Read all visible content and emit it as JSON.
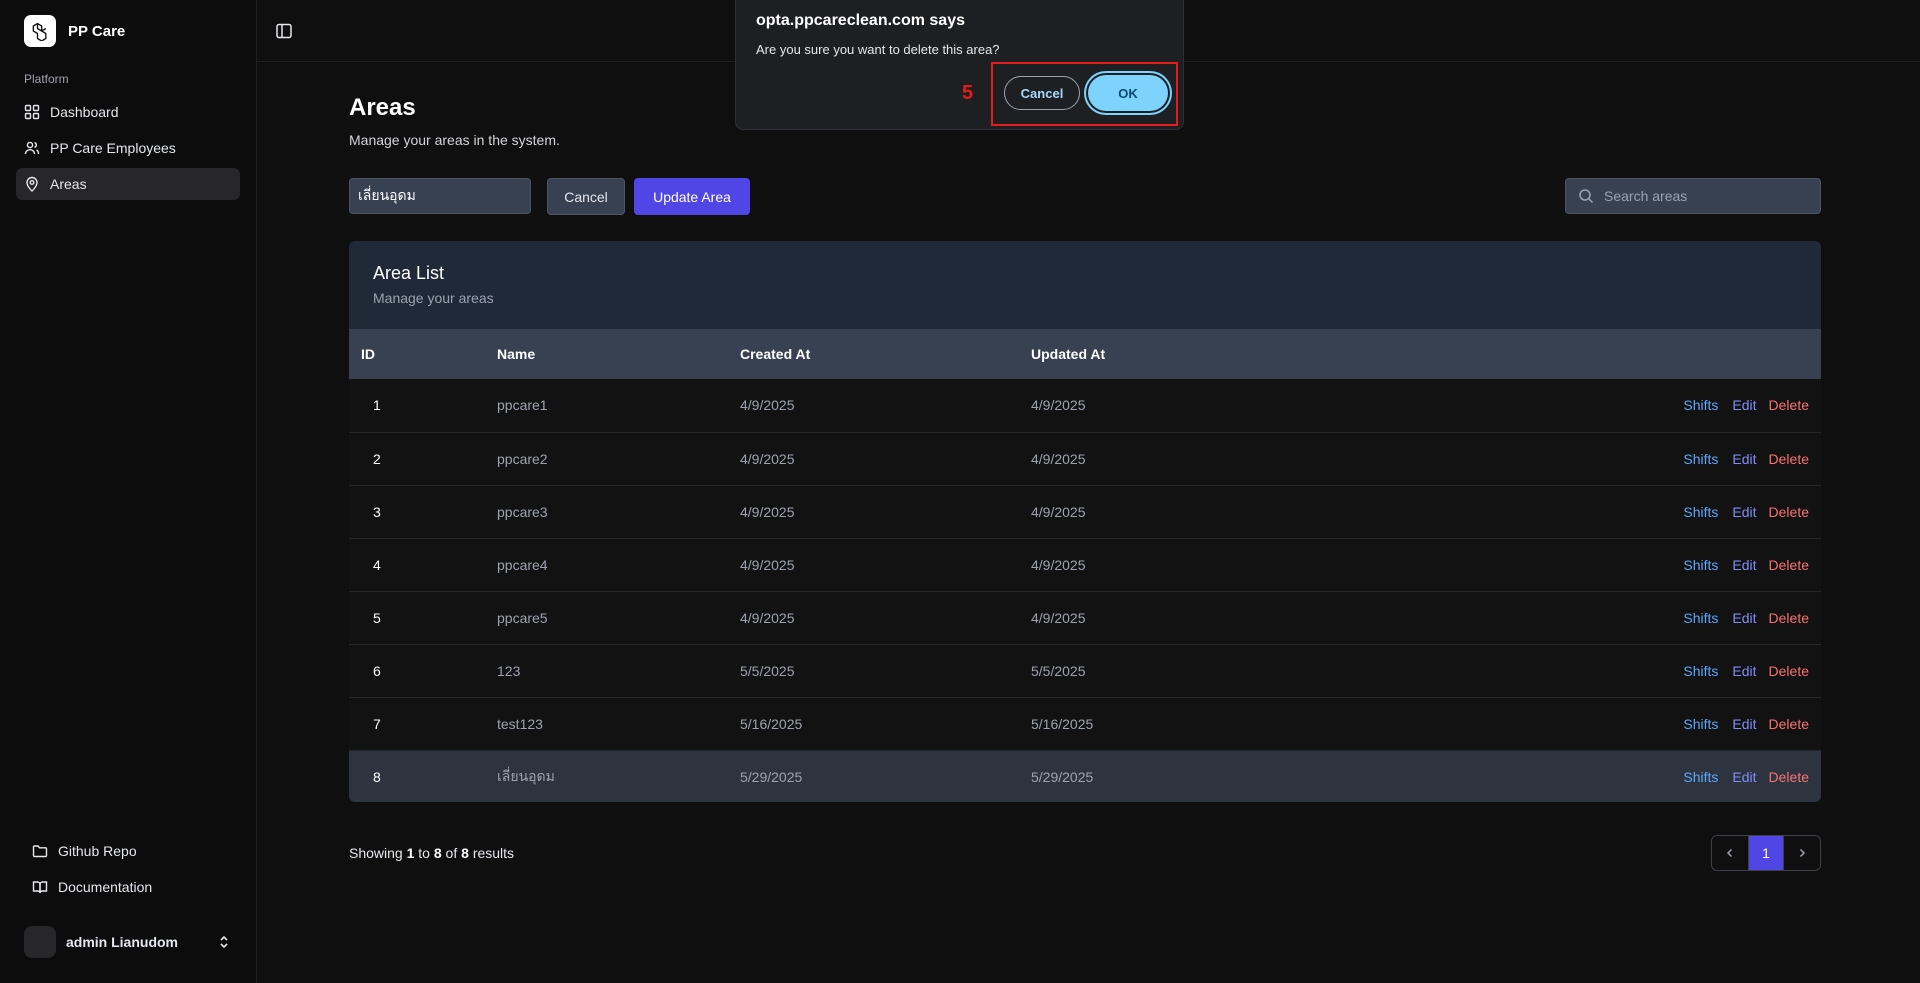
{
  "sidebar": {
    "brand": "PP Care",
    "section_label": "Platform",
    "items": [
      {
        "label": "Dashboard",
        "icon": "dashboard-grid-icon"
      },
      {
        "label": "PP Care Employees",
        "icon": "users-icon"
      },
      {
        "label": "Areas",
        "icon": "map-pin-icon",
        "active": true
      }
    ],
    "footer_items": [
      {
        "label": "Github Repo",
        "icon": "folder-icon"
      },
      {
        "label": "Documentation",
        "icon": "book-open-icon"
      }
    ],
    "user": {
      "name": "admin Lianudom"
    }
  },
  "page": {
    "title": "Areas",
    "subtitle": "Manage your areas in the system."
  },
  "toolbar": {
    "name_value": "เลี่ยนอุดม",
    "cancel_label": "Cancel",
    "update_label": "Update Area",
    "search_placeholder": "Search areas"
  },
  "card": {
    "title": "Area List",
    "subtitle": "Manage your areas",
    "columns": [
      "ID",
      "Name",
      "Created At",
      "Updated At"
    ],
    "action_labels": {
      "shifts": "Shifts",
      "edit": "Edit",
      "delete": "Delete"
    },
    "rows": [
      {
        "id": "1",
        "name": "ppcare1",
        "created": "4/9/2025",
        "updated": "4/9/2025"
      },
      {
        "id": "2",
        "name": "ppcare2",
        "created": "4/9/2025",
        "updated": "4/9/2025"
      },
      {
        "id": "3",
        "name": "ppcare3",
        "created": "4/9/2025",
        "updated": "4/9/2025"
      },
      {
        "id": "4",
        "name": "ppcare4",
        "created": "4/9/2025",
        "updated": "4/9/2025"
      },
      {
        "id": "5",
        "name": "ppcare5",
        "created": "4/9/2025",
        "updated": "4/9/2025"
      },
      {
        "id": "6",
        "name": "123",
        "created": "5/5/2025",
        "updated": "5/5/2025"
      },
      {
        "id": "7",
        "name": "test123",
        "created": "5/16/2025",
        "updated": "5/16/2025"
      },
      {
        "id": "8",
        "name": "เลี่ยนอุดม",
        "created": "5/29/2025",
        "updated": "5/29/2025"
      }
    ]
  },
  "pagination": {
    "showing_prefix": "Showing",
    "from": "1",
    "to_word": "to",
    "to": "8",
    "of_word": "of",
    "total": "8",
    "results_word": "results",
    "current_page": "1"
  },
  "dialog": {
    "title": "opta.ppcareclean.com says",
    "message": "Are you sure you want to delete this area?",
    "cancel_label": "Cancel",
    "ok_label": "OK"
  },
  "annotation": {
    "step": "5"
  },
  "colors": {
    "accent": "#4f46e5",
    "shifts": "#60a5fa",
    "edit": "#818cf8",
    "delete": "#f87171",
    "highlight": "#e11d1d"
  }
}
